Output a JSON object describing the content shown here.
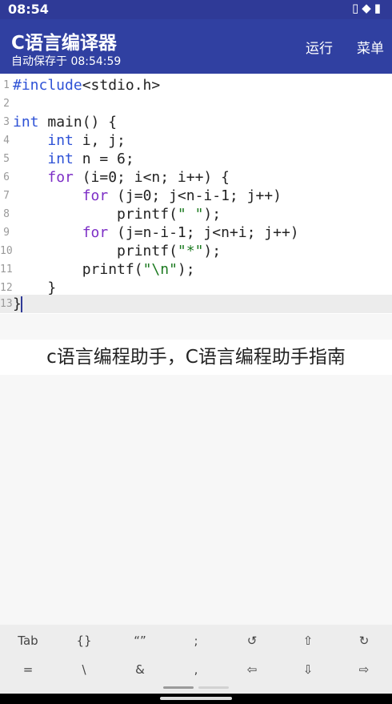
{
  "status_bar": {
    "time": "08:54",
    "icons": "▯◆▮"
  },
  "app_bar": {
    "title": "C语言编译器",
    "subtitle": "自动保存于 08:54:59",
    "actions": {
      "run": "运行",
      "menu": "菜单"
    }
  },
  "editor": {
    "lines": [
      {
        "n": "1",
        "parts": [
          {
            "t": "#include",
            "c": "kw"
          },
          {
            "t": "<stdio.h>",
            "c": ""
          }
        ]
      },
      {
        "n": "2",
        "parts": []
      },
      {
        "n": "3",
        "parts": [
          {
            "t": "int",
            "c": "kw"
          },
          {
            "t": " main() {",
            "c": ""
          }
        ]
      },
      {
        "n": "4",
        "parts": [
          {
            "t": "    ",
            "c": ""
          },
          {
            "t": "int",
            "c": "kw"
          },
          {
            "t": " i, j;",
            "c": ""
          }
        ]
      },
      {
        "n": "5",
        "parts": [
          {
            "t": "    ",
            "c": ""
          },
          {
            "t": "int",
            "c": "kw"
          },
          {
            "t": " n = 6;",
            "c": ""
          }
        ]
      },
      {
        "n": "6",
        "parts": [
          {
            "t": "    ",
            "c": ""
          },
          {
            "t": "for",
            "c": "kw2"
          },
          {
            "t": " (i=0; i<n; i++) {",
            "c": ""
          }
        ]
      },
      {
        "n": "7",
        "parts": [
          {
            "t": "        ",
            "c": ""
          },
          {
            "t": "for",
            "c": "kw2"
          },
          {
            "t": " (j=0; j<n-i-1; j++)",
            "c": ""
          }
        ]
      },
      {
        "n": "8",
        "parts": [
          {
            "t": "            printf(",
            "c": ""
          },
          {
            "t": "\" \"",
            "c": "str"
          },
          {
            "t": ");",
            "c": ""
          }
        ]
      },
      {
        "n": "9",
        "parts": [
          {
            "t": "        ",
            "c": ""
          },
          {
            "t": "for",
            "c": "kw2"
          },
          {
            "t": " (j=n-i-1; j<n+i; j++)",
            "c": ""
          }
        ]
      },
      {
        "n": "10",
        "parts": [
          {
            "t": "            printf(",
            "c": ""
          },
          {
            "t": "\"*\"",
            "c": "str"
          },
          {
            "t": ");",
            "c": ""
          }
        ]
      },
      {
        "n": "11",
        "parts": [
          {
            "t": "        printf(",
            "c": ""
          },
          {
            "t": "\"\\n\"",
            "c": "str"
          },
          {
            "t": ");",
            "c": ""
          }
        ]
      },
      {
        "n": "12",
        "parts": [
          {
            "t": "    }",
            "c": ""
          }
        ]
      },
      {
        "n": "13",
        "parts": [
          {
            "t": "}",
            "c": ""
          }
        ]
      }
    ]
  },
  "caption": "c语言编程助手，C语言编程助手指南",
  "keys": {
    "row1": [
      "Tab",
      "{}",
      "“”",
      ";",
      "↺",
      "⇧",
      "↻"
    ],
    "row2": [
      "=",
      "\\",
      "&",
      ",",
      "⇦",
      "⇩",
      "⇨"
    ]
  },
  "colors": {
    "app_bar": "#3040a1",
    "status_bar": "#2f3a97",
    "keyword": "#2e52d6",
    "control_keyword": "#7d2fc6",
    "string": "#1c7a20"
  }
}
